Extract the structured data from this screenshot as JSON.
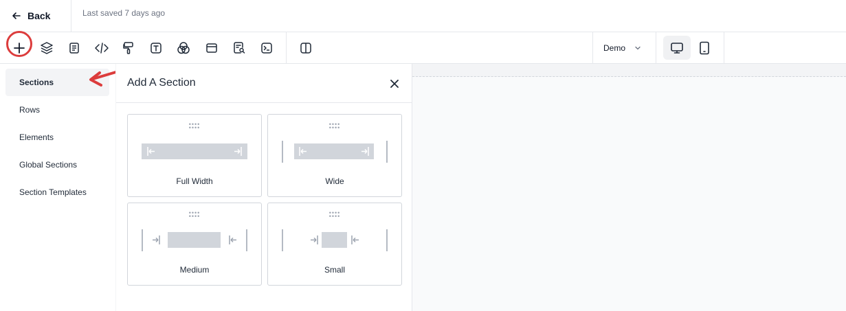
{
  "header": {
    "back_label": "Back",
    "saved_status": "Last saved 7 days ago"
  },
  "toolbar": {
    "icons": [
      "plus-icon",
      "layers-icon",
      "page-icon",
      "code-icon",
      "paint-roller-icon",
      "text-icon",
      "blend-icon",
      "browser-window-icon",
      "search-document-icon",
      "terminal-icon",
      "split-view-icon"
    ],
    "project_selector": "Demo",
    "devices": [
      "desktop-icon",
      "tablet-icon"
    ],
    "annotation_color": "#dc3c3c"
  },
  "nav": {
    "items": [
      {
        "label": "Sections",
        "active": true
      },
      {
        "label": "Rows"
      },
      {
        "label": "Elements"
      },
      {
        "label": "Global Sections"
      },
      {
        "label": "Section Templates"
      }
    ]
  },
  "panel": {
    "title": "Add A Section",
    "options": [
      {
        "label": "Full Width"
      },
      {
        "label": "Wide"
      },
      {
        "label": "Medium"
      },
      {
        "label": "Small"
      }
    ]
  }
}
